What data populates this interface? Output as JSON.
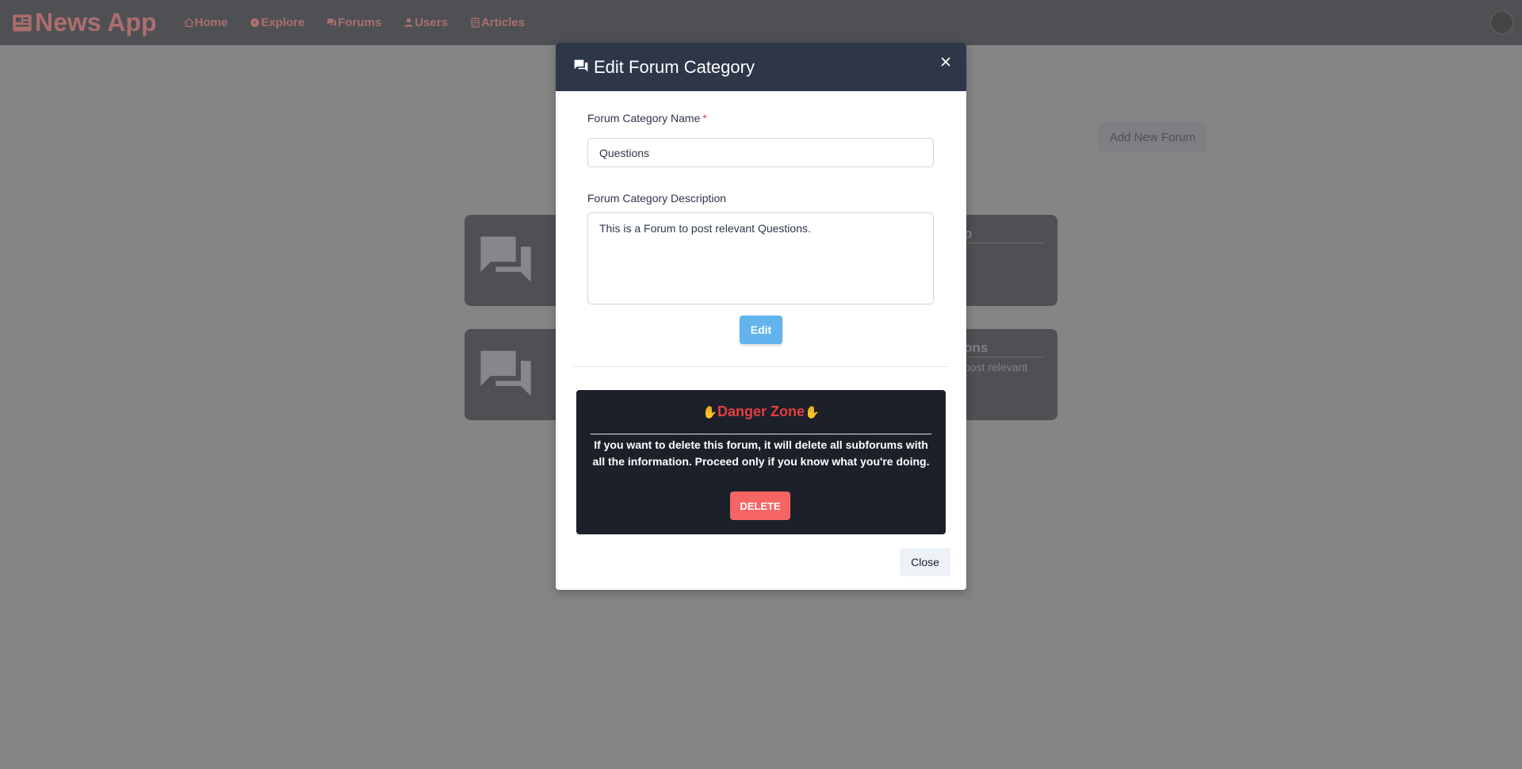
{
  "navbar": {
    "brand": "News App",
    "items": [
      {
        "label": "Home",
        "icon": "home-icon"
      },
      {
        "label": "Explore",
        "icon": "compass-icon"
      },
      {
        "label": "Forums",
        "icon": "chat-icon"
      },
      {
        "label": "Users",
        "icon": "user-icon"
      },
      {
        "label": "Articles",
        "icon": "article-icon"
      }
    ],
    "accent_color": "#d95c5c"
  },
  "page": {
    "add_forum_label": "Add New Forum",
    "cards": [
      {
        "title_partial": "p",
        "desc_partial": ""
      },
      {
        "title_partial": "ons",
        "desc_partial": "post relevant"
      }
    ]
  },
  "modal": {
    "title": "Edit Forum Category",
    "name_label": "Forum Category Name",
    "required_mark": "*",
    "name_value": "Questions",
    "description_label": "Forum Category Description",
    "description_value": "This is a Forum to post relevant Questions.",
    "edit_label": "Edit",
    "danger": {
      "title": "Danger Zone",
      "hand_left": "✋",
      "hand_right": "✋",
      "text": "If you want to delete this forum, it will delete all subforums with all the information. Proceed only if you know what you're doing.",
      "delete_label": "DELETE"
    },
    "close_label": "Close"
  }
}
